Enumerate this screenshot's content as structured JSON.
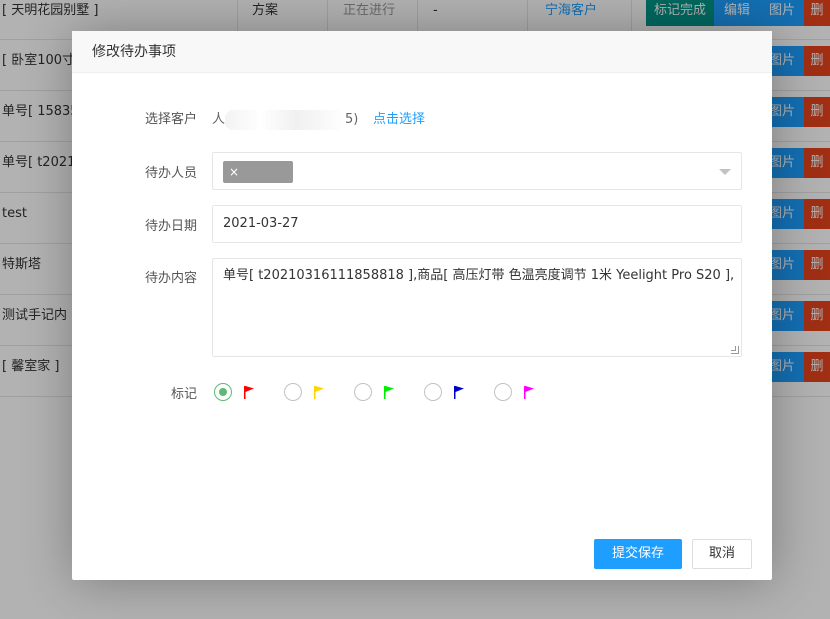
{
  "background_table": {
    "rows": [
      {
        "name": "[ 天明花园别墅 ]",
        "type": "方案",
        "status": "正在进行",
        "dash": "-",
        "client": "宁海客户"
      },
      {
        "name": "[ 卧室100寸"
      },
      {
        "name": "单号[ 15835"
      },
      {
        "name": "单号[ t2021"
      },
      {
        "name": "test"
      },
      {
        "name": "特斯塔"
      },
      {
        "name": "测试手记内"
      },
      {
        "name": "[ 馨室家 ]"
      }
    ],
    "actions": {
      "mark_done": "标记完成",
      "edit": "编辑",
      "image": "图片",
      "delete": "删"
    }
  },
  "dialog": {
    "title": "修改待办事项",
    "client_label": "选择客户",
    "client_value_prefix": "人",
    "client_value_suffix": "5)",
    "choose_link": "点击选择",
    "assignee_label": "待办人员",
    "date_label": "待办日期",
    "date_value": "2021-03-27",
    "content_label": "待办内容",
    "content_value": "单号[ t20210316111858818 ],商品[ 高压灯带 色温亮度调节 1米 Yeelight Pro S20 ],",
    "mark_label": "标记",
    "flags": [
      {
        "color": "#ff0000",
        "checked": true
      },
      {
        "color": "#ffd400",
        "checked": false
      },
      {
        "color": "#00ee00",
        "checked": false
      },
      {
        "color": "#0000cc",
        "checked": false
      },
      {
        "color": "#ff00ff",
        "checked": false
      }
    ],
    "submit_label": "提交保存",
    "cancel_label": "取消"
  }
}
